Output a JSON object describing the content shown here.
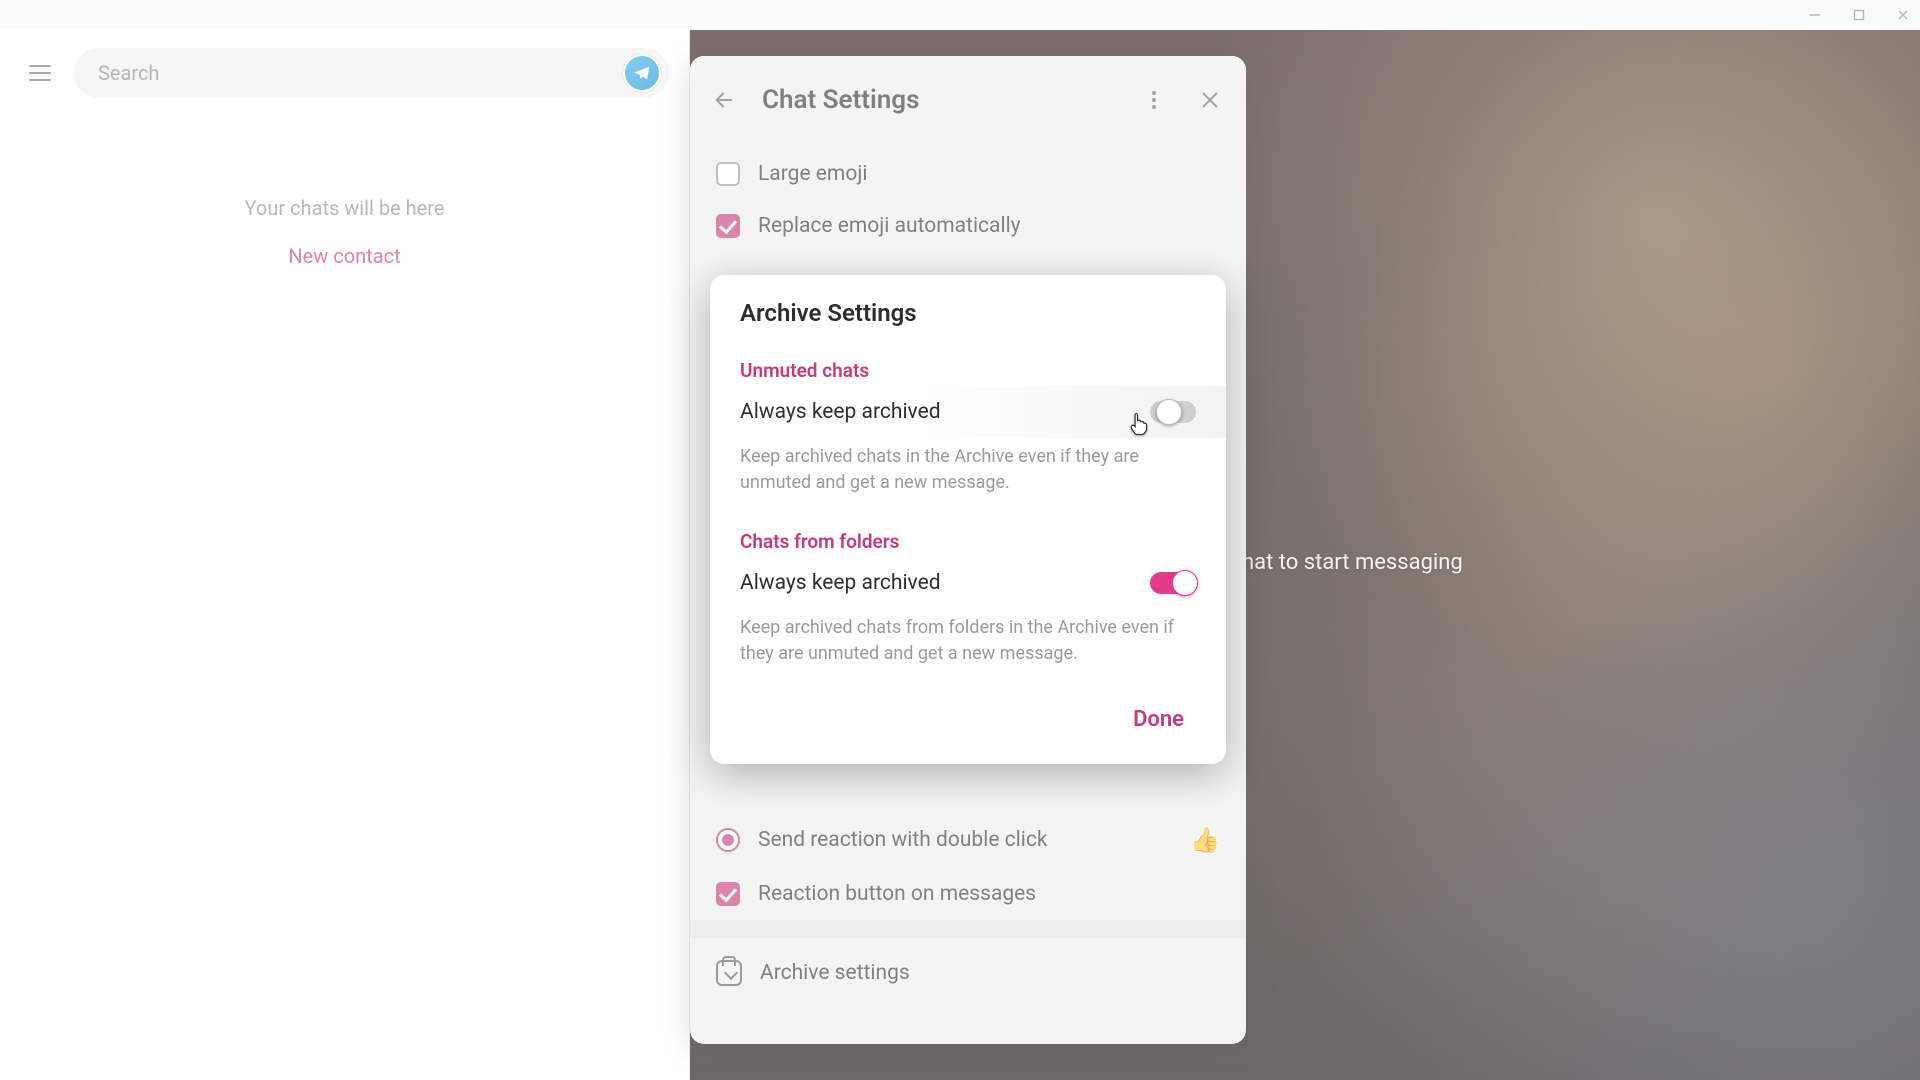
{
  "titlebar": {
    "app": "Telegram"
  },
  "search": {
    "placeholder": "Search"
  },
  "sidebar": {
    "empty_msg": "Your chats will be here",
    "new_contact": "New contact"
  },
  "content": {
    "start_hint": "Select a chat to start messaging"
  },
  "settings": {
    "title": "Chat Settings",
    "rows": {
      "large_emoji": "Large emoji",
      "replace_emoji": "Replace emoji automatically",
      "reaction_double_click": "Send reaction with double click",
      "reaction_emoji": "👍",
      "reaction_button": "Reaction button on messages",
      "archive_settings": "Archive settings"
    }
  },
  "archive_modal": {
    "title": "Archive Settings",
    "section_unmuted": "Unmuted chats",
    "row_unmuted": "Always keep archived",
    "desc_unmuted": "Keep archived chats in the Archive even if they are unmuted and get a new message.",
    "section_folders": "Chats from folders",
    "row_folders": "Always keep archived",
    "desc_folders": "Keep archived chats from folders in the Archive even if they are unmuted and get a new message.",
    "done": "Done"
  }
}
